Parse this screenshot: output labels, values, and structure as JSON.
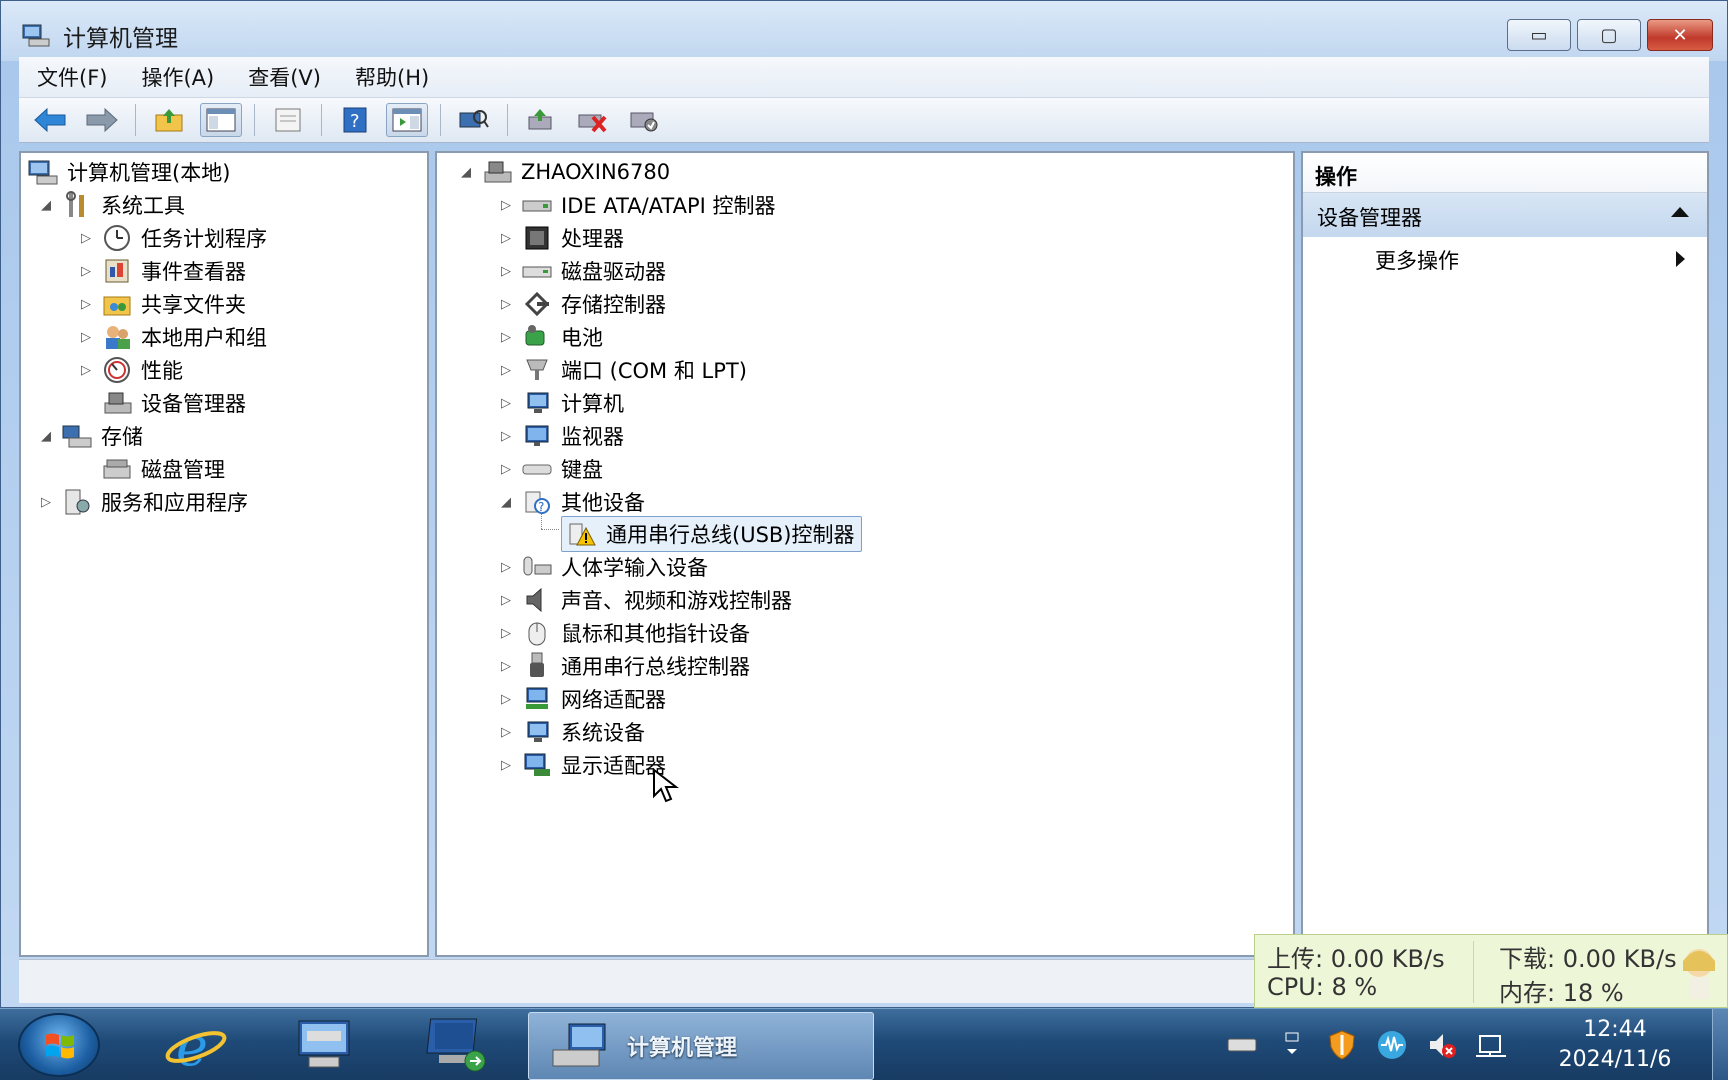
{
  "window": {
    "title": "计算机管理",
    "buttons": {
      "minimize": "▭",
      "maximize": "▢",
      "close": "✕"
    }
  },
  "menu": [
    "文件(F)",
    "操作(A)",
    "查看(V)",
    "帮助(H)"
  ],
  "left_tree": {
    "root": "计算机管理(本地)",
    "system_tools": "系统工具",
    "task_scheduler": "任务计划程序",
    "event_viewer": "事件查看器",
    "shared_folders": "共享文件夹",
    "local_users": "本地用户和组",
    "performance": "性能",
    "device_manager": "设备管理器",
    "storage": "存储",
    "disk_management": "磁盘管理",
    "services_apps": "服务和应用程序"
  },
  "device_tree": {
    "computer_name": "ZHAOXIN6780",
    "categories": [
      "IDE ATA/ATAPI 控制器",
      "处理器",
      "磁盘驱动器",
      "存储控制器",
      "电池",
      "端口 (COM 和 LPT)",
      "计算机",
      "监视器",
      "键盘",
      "其他设备",
      "通用串行总线(USB)控制器",
      "人体学输入设备",
      "声音、视频和游戏控制器",
      "鼠标和其他指针设备",
      "通用串行总线控制器",
      "网络适配器",
      "系统设备",
      "显示适配器"
    ]
  },
  "actions": {
    "header": "操作",
    "group": "设备管理器",
    "more": "更多操作"
  },
  "net_monitor": {
    "upload": "上传: 0.00 KB/s",
    "download": "下载: 0.00 KB/s",
    "cpu": "CPU: 8 %",
    "memory": "内存: 18 %"
  },
  "taskbar": {
    "active_app": "计算机管理",
    "time": "12:44",
    "date": "2024/11/6"
  }
}
